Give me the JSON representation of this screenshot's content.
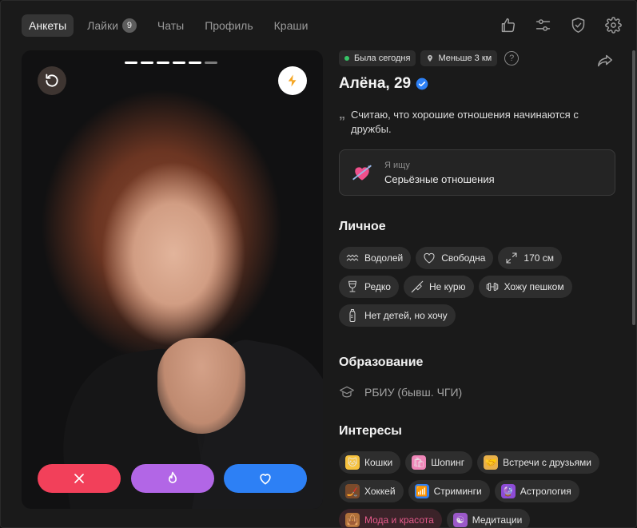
{
  "nav": {
    "tabs": [
      {
        "label": "Анкеты",
        "active": true
      },
      {
        "label": "Лайки",
        "badge": "9"
      },
      {
        "label": "Чаты"
      },
      {
        "label": "Профиль"
      },
      {
        "label": "Краши"
      }
    ],
    "right_icons": [
      "thumbs-up-icon",
      "filters-icon",
      "shield-check-icon",
      "settings-gear-icon"
    ]
  },
  "photo": {
    "slides_total": 6,
    "slide_current": 5,
    "left_button_icon": "rewind-icon",
    "right_button_icon": "lightning-boost-icon",
    "actions": [
      {
        "name": "dislike",
        "icon": "cross-icon",
        "color": "#f2405a"
      },
      {
        "name": "super-like",
        "icon": "flame-icon",
        "color": "#b266e6"
      },
      {
        "name": "like",
        "icon": "heart-icon",
        "color": "#2d80f5"
      }
    ]
  },
  "profile": {
    "status": "Была сегодня",
    "status_color": "#37c467",
    "distance": "Меньше 3 км",
    "help": "?",
    "name": "Алёна, 29",
    "verified_color": "#2d80f5",
    "bio_quote": "„",
    "bio": "Считаю, что хорошие отношения начинаются с дружбы.",
    "looking_for_label": "Я ищу",
    "looking_for_value": "Серьёзные отношения"
  },
  "personal": {
    "title": "Личное",
    "items": [
      {
        "icon": "aquarius-icon",
        "label": "Водолей"
      },
      {
        "icon": "heart-outline-icon",
        "label": "Свободна"
      },
      {
        "icon": "height-arrows-icon",
        "label": "170 см"
      },
      {
        "icon": "wine-glass-icon",
        "label": "Редко"
      },
      {
        "icon": "no-smoking-icon",
        "label": "Не курю"
      },
      {
        "icon": "dumbbell-icon",
        "label": "Хожу пешком"
      },
      {
        "icon": "baby-bottle-icon",
        "label": "Нет детей, но хочу"
      }
    ]
  },
  "education": {
    "title": "Образование",
    "value": "РБИУ (бывш. ЧГИ)"
  },
  "interests": {
    "title": "Интересы",
    "items": [
      {
        "icon": "cat-icon",
        "label": "Кошки",
        "emoji": "🐱"
      },
      {
        "icon": "shopping-bag-icon",
        "label": "Шопинг",
        "emoji": "🛍"
      },
      {
        "icon": "handshake-icon",
        "label": "Встречи с друзьями",
        "emoji": "🤝"
      },
      {
        "icon": "hockey-stick-icon",
        "label": "Хоккей",
        "emoji": "🏒"
      },
      {
        "icon": "wifi-stream-icon",
        "label": "Стриминги",
        "emoji": "📶"
      },
      {
        "icon": "crystal-ball-icon",
        "label": "Астрология",
        "emoji": "🔮"
      },
      {
        "icon": "handbag-icon",
        "label": "Мода и красота",
        "emoji": "👜",
        "highlight": true
      },
      {
        "icon": "yin-yang-icon",
        "label": "Медитации",
        "emoji": "☯"
      }
    ]
  }
}
